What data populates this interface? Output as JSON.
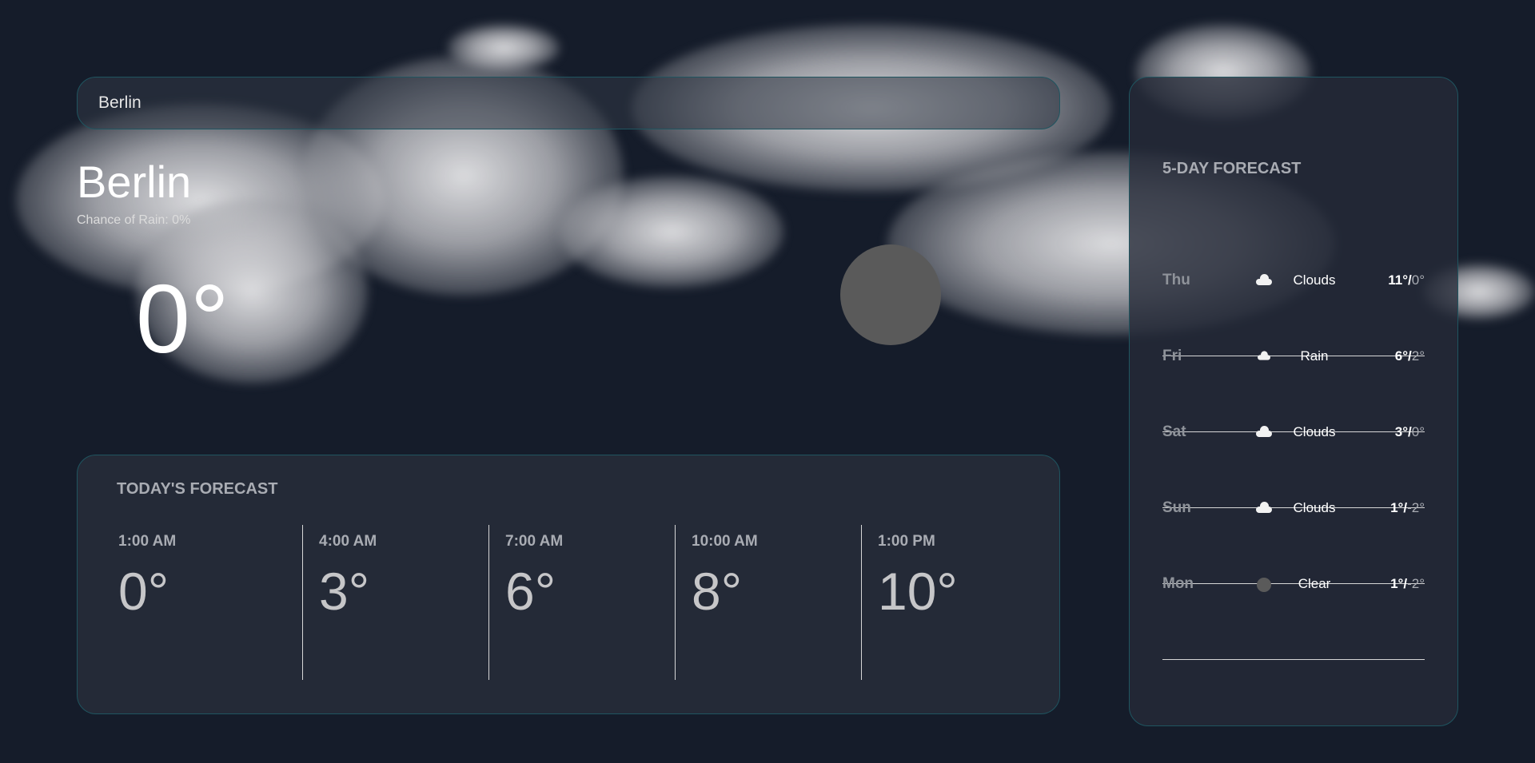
{
  "search": {
    "value": "Berlin"
  },
  "current": {
    "city": "Berlin",
    "chance_of_rain": "Chance of Rain: 0%",
    "temp": "0°"
  },
  "today": {
    "title": "TODAY'S FORECAST",
    "hours": [
      {
        "time": "1:00 AM",
        "temp": "0°"
      },
      {
        "time": "4:00 AM",
        "temp": "3°"
      },
      {
        "time": "7:00 AM",
        "temp": "6°"
      },
      {
        "time": "10:00 AM",
        "temp": "8°"
      },
      {
        "time": "1:00 PM",
        "temp": "10°"
      }
    ]
  },
  "five_day": {
    "title": "5-DAY FORECAST",
    "days": [
      {
        "day": "Thu",
        "icon": "cloud-icon",
        "condition": "Clouds",
        "high": "11°",
        "low": "0°"
      },
      {
        "day": "Fri",
        "icon": "rain-cloud-icon",
        "condition": "Rain",
        "high": "6°",
        "low": "2°"
      },
      {
        "day": "Sat",
        "icon": "cloud-icon",
        "condition": "Clouds",
        "high": "3°",
        "low": "0°"
      },
      {
        "day": "Sun",
        "icon": "cloud-icon",
        "condition": "Clouds",
        "high": "1°",
        "low": "-2°"
      },
      {
        "day": "Mon",
        "icon": "clear-icon",
        "condition": "Clear",
        "high": "1°",
        "low": "-2°"
      }
    ]
  }
}
